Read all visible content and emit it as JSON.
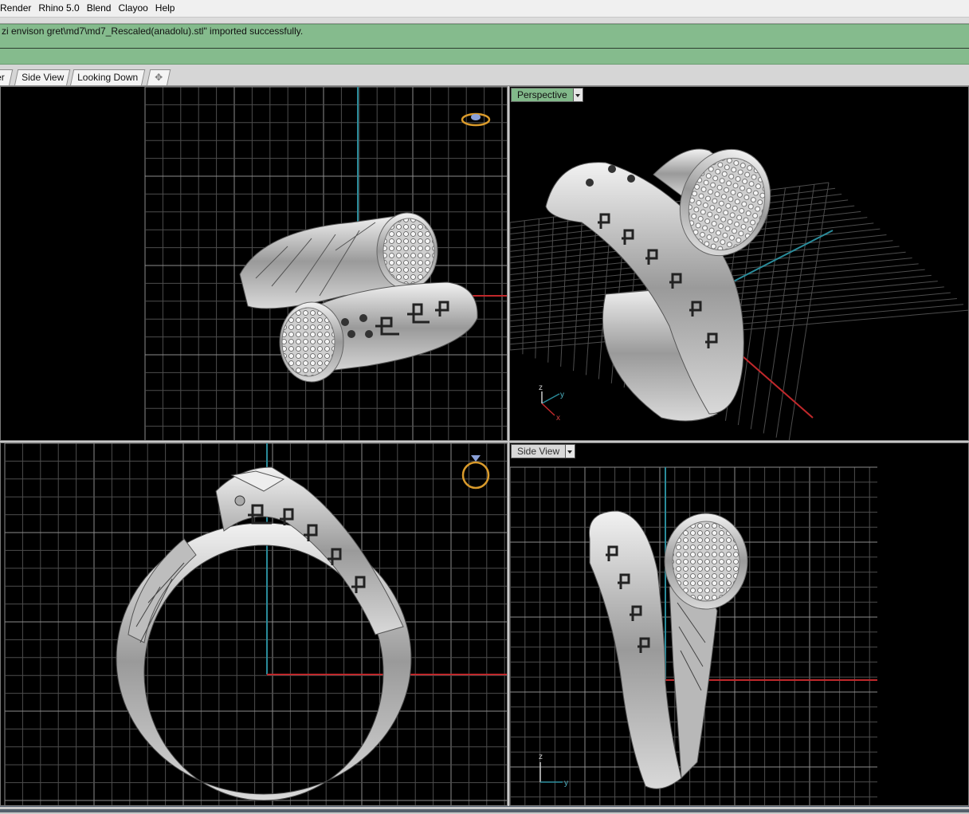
{
  "menu": {
    "items": [
      "Render",
      "Rhino 5.0",
      "Blend",
      "Clayoo",
      "Help"
    ]
  },
  "command_history": {
    "text": "zi envison gret\\md7\\md7_Rescaled(anadolu).stl\" imported successfully."
  },
  "tabs": [
    {
      "label": "er"
    },
    {
      "label": "Side View"
    },
    {
      "label": "Looking Down"
    },
    {
      "label": "✥"
    }
  ],
  "viewports": {
    "top_right": {
      "label": "Perspective"
    },
    "bottom_right": {
      "label": "Side View"
    }
  },
  "axes": {
    "perspective": {
      "x": "x",
      "y": "y",
      "z": "z"
    },
    "side": {
      "y": "y",
      "z": "z"
    }
  },
  "colors": {
    "grid": "#4d4d4d",
    "grid_major": "#8c8c8c",
    "axis_x": "#c0282b",
    "axis_y": "#2a8b9a",
    "command_bg": "#85bb8d",
    "metal_light": "#e8e8e8",
    "metal_dark": "#6a6a6a"
  },
  "icons": {
    "tab_add": "new-tab-icon",
    "ring_widget": "ring-orientation-icon",
    "dropdown": "chevron-down-icon"
  }
}
